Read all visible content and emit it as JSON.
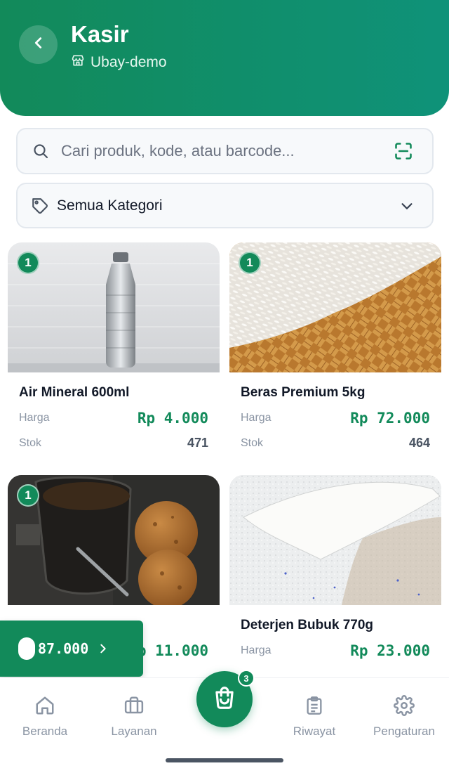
{
  "header": {
    "title": "Kasir",
    "store_name": "Ubay-demo",
    "back_icon": "chevron-left-icon",
    "store_icon": "store-icon"
  },
  "search": {
    "placeholder": "Cari produk, kode, atau barcode...",
    "search_icon": "search-icon",
    "scan_icon": "barcode-scan-icon"
  },
  "category": {
    "selected": "Semua Kategori",
    "tag_icon": "tag-icon",
    "chevron_icon": "chevron-down-icon"
  },
  "labels": {
    "price": "Harga",
    "stock": "Stok"
  },
  "products": [
    {
      "name": "Air Mineral 600ml",
      "price": "Rp 4.000",
      "stock": "471",
      "qty_in_cart": "1",
      "image": "water-bottle-photo"
    },
    {
      "name": "Beras Premium 5kg",
      "price": "Rp 72.000",
      "stock": "464",
      "qty_in_cart": "1",
      "image": "rice-photo"
    },
    {
      "name": "",
      "price": "Rp 11.000",
      "stock": "",
      "qty_in_cart": "1",
      "image": "cookies-coffee-photo"
    },
    {
      "name": "Deterjen Bubuk 770g",
      "price": "Rp 23.000",
      "stock": "",
      "qty_in_cart": "",
      "image": "detergent-powder-photo"
    }
  ],
  "cart_total": {
    "amount": "87.000",
    "arrow_icon": "chevron-right-icon"
  },
  "bottom_nav": {
    "items": [
      {
        "label": "Beranda",
        "icon": "home-icon"
      },
      {
        "label": "Layanan",
        "icon": "briefcase-icon"
      },
      {
        "label": "Riwayat",
        "icon": "clipboard-icon"
      },
      {
        "label": "Pengaturan",
        "icon": "gear-icon"
      }
    ],
    "cart_count": "3",
    "cart_icon": "shopping-bag-icon"
  },
  "colors": {
    "primary": "#128a5a",
    "primary_end": "#0f9279",
    "muted": "#8a94a3"
  }
}
